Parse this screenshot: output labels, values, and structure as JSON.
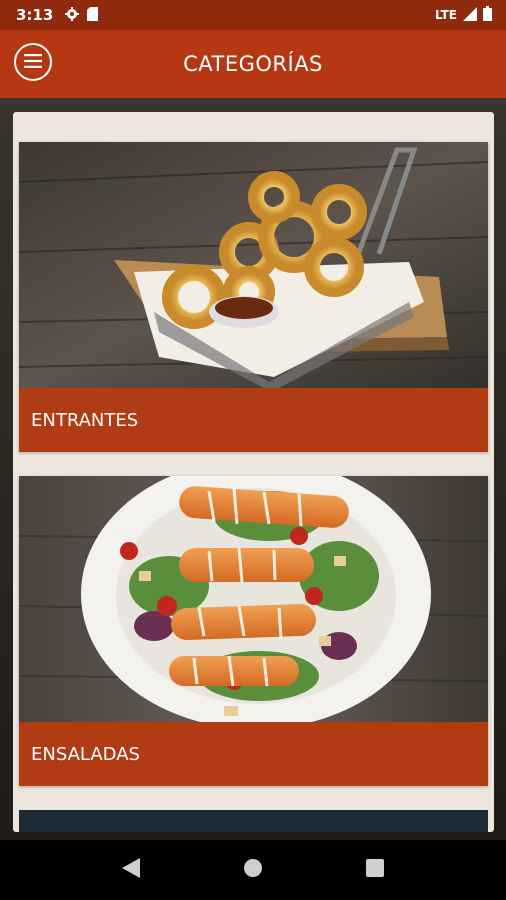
{
  "status": {
    "time": "3:13",
    "network": "LTE"
  },
  "appbar": {
    "title": "CATEGORÍAS"
  },
  "categories": [
    {
      "label": "ENTRANTES"
    },
    {
      "label": "ENSALADAS"
    }
  ],
  "colors": {
    "statusbar": "#8f2a0c",
    "appbar": "#b63812",
    "card_label": "#b13b12",
    "panel": "#ece6dc"
  },
  "icons": [
    "settings-icon",
    "sd-card-icon",
    "signal-icon",
    "battery-icon",
    "menu-icon",
    "back-icon",
    "home-icon",
    "recents-icon"
  ]
}
